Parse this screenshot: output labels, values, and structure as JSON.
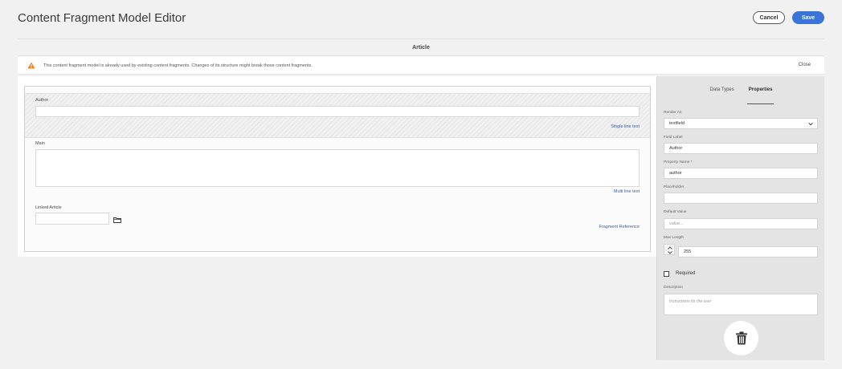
{
  "header": {
    "title": "Content Fragment Model Editor",
    "cancel_label": "Cancel",
    "save_label": "Save"
  },
  "model": {
    "name": "Article"
  },
  "alert": {
    "message": "This content fragment model is already used by existing content fragments. Changes of its structure might break those content fragments.",
    "close_label": "Close"
  },
  "canvas": {
    "fields": [
      {
        "label": "Author",
        "type": "Single line text"
      },
      {
        "label": "Main",
        "type": "Multi line text"
      },
      {
        "label": "Linked Article",
        "type": "Fragment Reference"
      }
    ]
  },
  "panel": {
    "tabs": [
      {
        "label": "Data Types",
        "active": false
      },
      {
        "label": "Properties",
        "active": true
      }
    ],
    "render_as_label": "Render As",
    "render_as_value": "textfield",
    "field_label_label": "Field Label",
    "field_label_value": "Author",
    "property_name_label": "Property Name *",
    "property_name_value": "author",
    "placeholder_label": "Placeholder",
    "placeholder_value": "",
    "default_value_label": "Default Value",
    "default_value_placeholder": "value...",
    "max_length_label": "Max Length",
    "max_length_value": "255",
    "required_label": "Required",
    "required_checked": false,
    "description_label": "Description",
    "description_placeholder": "Instructions for the user"
  },
  "colors": {
    "accent": "#3b74d9",
    "warning": "#e68619",
    "link": "#3b5ea8"
  }
}
